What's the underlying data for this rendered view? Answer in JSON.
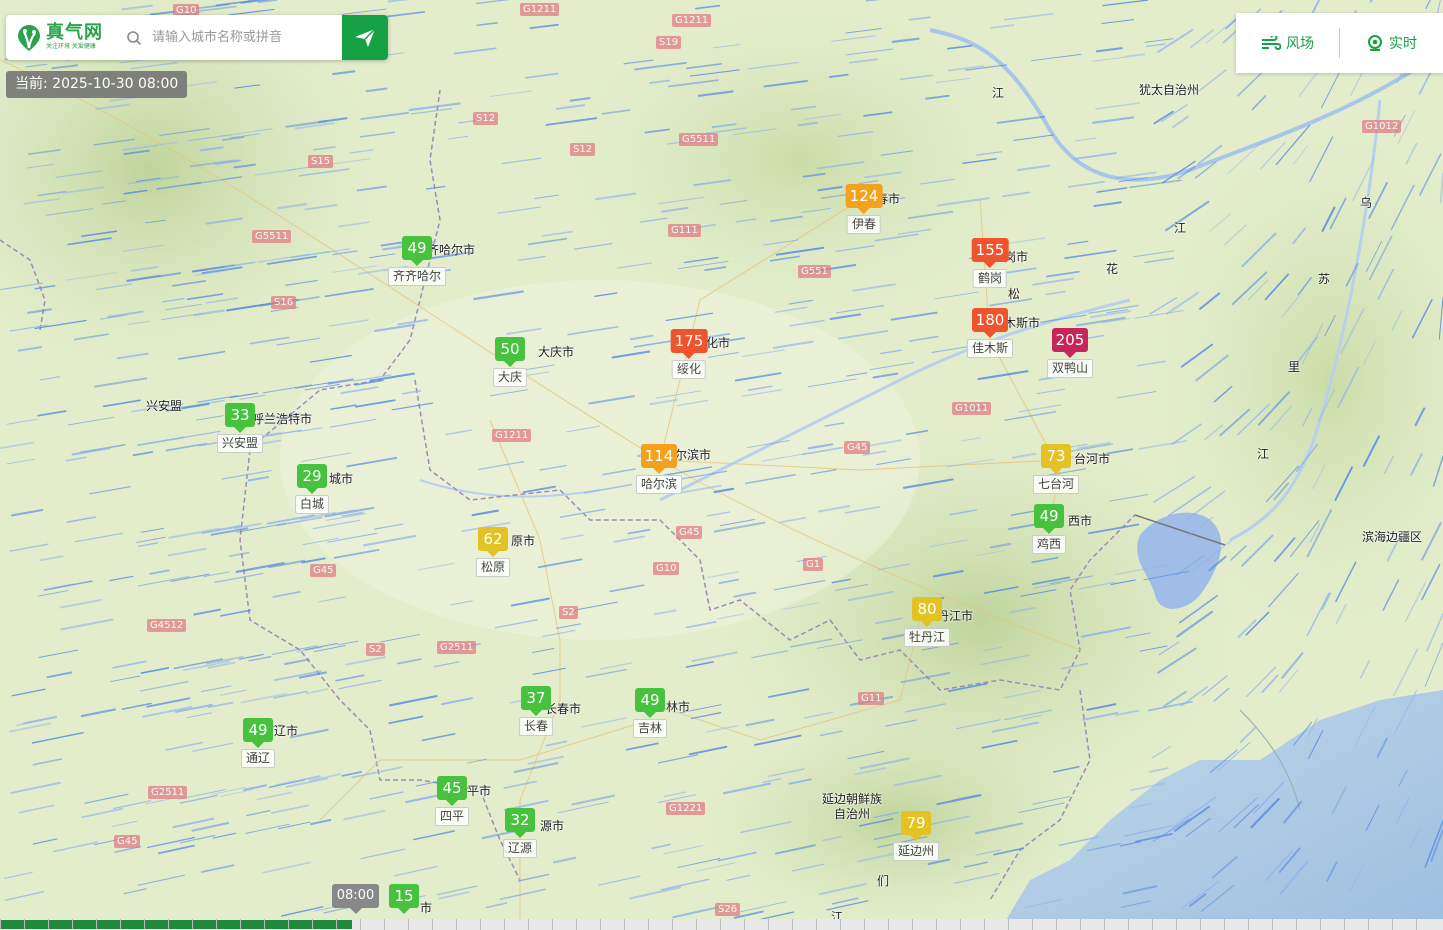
{
  "search": {
    "placeholder": "请输入城市名称或拼音"
  },
  "brand": {
    "name": "真气网",
    "slogan": "关注环境 关爱健康"
  },
  "current_time": "当前: 2025-10-30 08:00",
  "controls": {
    "wind_label": "风场",
    "realtime_label": "实时"
  },
  "timeline": {
    "pin_label": "08:00"
  },
  "colors": {
    "green": "#47c23f",
    "yellow": "#e3c324",
    "orange": "#f2a21c",
    "red": "#f0542e",
    "purple": "#c8265a",
    "brand": "#17a145"
  },
  "stations": [
    {
      "aqi": "49",
      "name": "齐齐哈尔",
      "level": "green"
    },
    {
      "aqi": "124",
      "name": "伊春",
      "level": "orange"
    },
    {
      "aqi": "155",
      "name": "鹤岗",
      "level": "red"
    },
    {
      "aqi": "180",
      "name": "佳木斯",
      "level": "red"
    },
    {
      "aqi": "205",
      "name": "双鸭山",
      "level": "purple"
    },
    {
      "aqi": "50",
      "name": "大庆",
      "level": "green"
    },
    {
      "aqi": "175",
      "name": "绥化",
      "level": "red"
    },
    {
      "aqi": "33",
      "name": "兴安盟",
      "level": "green"
    },
    {
      "aqi": "29",
      "name": "白城",
      "level": "green"
    },
    {
      "aqi": "114",
      "name": "哈尔滨",
      "level": "orange"
    },
    {
      "aqi": "73",
      "name": "七台河",
      "level": "yellow"
    },
    {
      "aqi": "49",
      "name": "鸡西",
      "level": "green"
    },
    {
      "aqi": "62",
      "name": "松原",
      "level": "yellow"
    },
    {
      "aqi": "80",
      "name": "牡丹江",
      "level": "yellow"
    },
    {
      "aqi": "37",
      "name": "长春",
      "level": "green"
    },
    {
      "aqi": "49",
      "name": "吉林",
      "level": "green"
    },
    {
      "aqi": "49",
      "name": "通辽",
      "level": "green"
    },
    {
      "aqi": "45",
      "name": "四平",
      "level": "green"
    },
    {
      "aqi": "32",
      "name": "辽源",
      "level": "green"
    },
    {
      "aqi": "79",
      "name": "延边州",
      "level": "yellow"
    },
    {
      "aqi": "15",
      "name": "",
      "level": "green"
    }
  ],
  "place_labels": [
    "犹太自治州",
    "兴安盟",
    "滨海边疆区",
    "延边朝鲜族",
    "自治州",
    "齐哈尔市",
    "大庆市",
    "化市",
    "尔滨市",
    "春市",
    "岗市",
    "木斯市",
    "台河市",
    "西市",
    "丹江市",
    "原市",
    "长春市",
    "林市",
    "辽市",
    "平市",
    "源市",
    "城市",
    "呼兰浩特市",
    "市",
    "江",
    "江",
    "花",
    "松",
    "乌",
    "苏",
    "里",
    "江",
    "江",
    "们"
  ],
  "roads": [
    "G10",
    "G1211",
    "G1211",
    "S19",
    "S12",
    "S12",
    "G5511",
    "S15",
    "G111",
    "G551",
    "G5511",
    "S16",
    "G1011",
    "G45",
    "G1211",
    "G45",
    "G10",
    "G1",
    "S2",
    "S2",
    "G2511",
    "G4512",
    "G45",
    "G2511",
    "G45",
    "G1221",
    "G11",
    "S26",
    "G1012"
  ]
}
